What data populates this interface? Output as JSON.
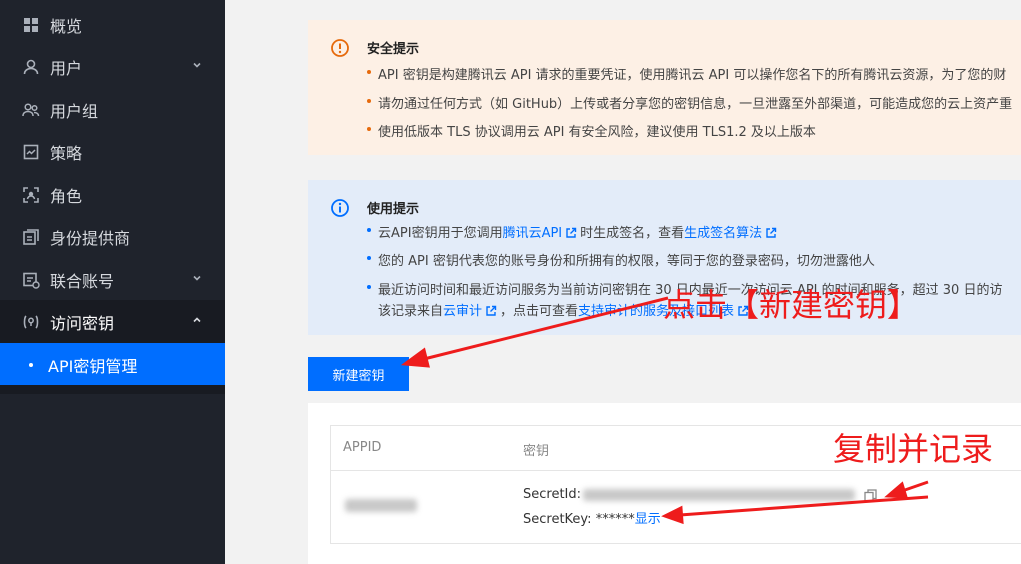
{
  "sidebar": {
    "items": [
      {
        "label": "概览",
        "icon": "grid-icon"
      },
      {
        "label": "用户",
        "icon": "user-icon",
        "chevron": "chevron-down-icon"
      },
      {
        "label": "用户组",
        "icon": "user-group-icon"
      },
      {
        "label": "策略",
        "icon": "policy-icon"
      },
      {
        "label": "角色",
        "icon": "role-icon"
      },
      {
        "label": "身份提供商",
        "icon": "identity-provider-icon"
      },
      {
        "label": "联合账号",
        "icon": "federated-account-icon",
        "chevron": "chevron-down-icon"
      },
      {
        "label": "访问密钥",
        "icon": "key-icon",
        "chevron": "chevron-up-icon"
      }
    ],
    "active_sub": "API密钥管理"
  },
  "security_tip": {
    "title": "安全提示",
    "items": [
      "API 密钥是构建腾讯云 API 请求的重要凭证，使用腾讯云 API 可以操作您名下的所有腾讯云资源，为了您的财",
      "请勿通过任何方式（如 GitHub）上传或者分享您的密钥信息，一旦泄露至外部渠道，可能造成您的云上资产重",
      "使用低版本 TLS 协议调用云 API 有安全风险，建议使用 TLS1.2 及以上版本"
    ]
  },
  "usage_tip": {
    "title": "使用提示",
    "item1_a": "云API密钥用于您调用",
    "item1_link1": "腾讯云API",
    "item1_b": "时生成签名，查看",
    "item1_link2": "生成签名算法",
    "item2": "您的 API 密钥代表您的账号身份和所拥有的权限，等同于您的登录密码，切勿泄露他人",
    "item3_line1": "最近访问时间和最近访问服务为当前访问密钥在 30 日内最近一次访问云 API 的时间和服务，超过 30 日的访",
    "item3_line2_a": "该记录来自",
    "item3_link1": "云审计",
    "item3_line2_b": "，点击可查看",
    "item3_link2": "支持审计的服务及接口列表"
  },
  "new_key_button": "新建密钥",
  "table": {
    "headers": [
      "APPID",
      "密钥"
    ],
    "secret_id_label": "SecretId:",
    "secret_key_label": "SecretKey:",
    "secret_key_masked": "******",
    "show_link": "显示"
  },
  "annotations": {
    "click_new_key": "点击【新建密钥】",
    "copy_and_record": "复制并记录"
  },
  "colors": {
    "sidebar_bg": "#1f232c",
    "active_blue": "#006eff",
    "warn_bg": "#fdf0e5",
    "info_bg": "#e3ecf9",
    "annotation_red": "#ee1c1c"
  }
}
